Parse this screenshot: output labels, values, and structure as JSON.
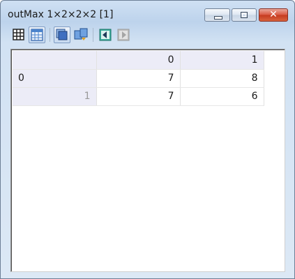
{
  "window": {
    "title": "outMax 1×2×2×2 [1]",
    "close_glyph": "✕"
  },
  "toolbar": {
    "icons": [
      "grid-icon",
      "table-view-icon",
      "layers-icon",
      "copy-pages-icon",
      "previous-page-icon",
      "next-page-icon"
    ]
  },
  "table": {
    "column_headers": [
      "0",
      "1"
    ],
    "rows": [
      {
        "header": "0",
        "cells": [
          "7",
          "8"
        ]
      },
      {
        "header": "1",
        "cells": [
          "7",
          "6"
        ]
      }
    ]
  },
  "colors": {
    "title_bar": "#bdd3ec",
    "header_bg": "#ececf7",
    "close_button": "#c53a20"
  }
}
